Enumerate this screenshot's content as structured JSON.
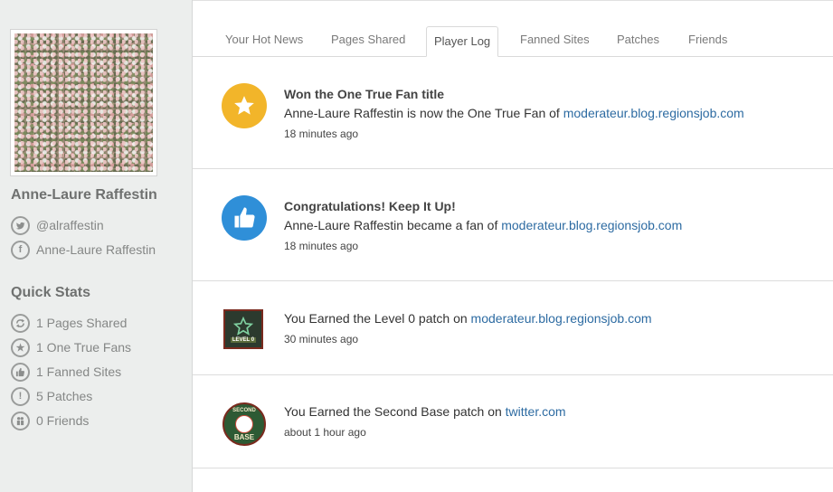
{
  "profile": {
    "name": "Anne-Laure Raffestin",
    "twitter": "@alraffestin",
    "facebook": "Anne-Laure Raffestin"
  },
  "quick_stats": {
    "title": "Quick Stats",
    "items": [
      {
        "label": "1 Pages Shared",
        "icon": "share-icon"
      },
      {
        "label": "1 One True Fans",
        "icon": "star-icon"
      },
      {
        "label": "1 Fanned Sites",
        "icon": "thumbs-up-icon"
      },
      {
        "label": "5 Patches",
        "icon": "exclamation-icon"
      },
      {
        "label": "0 Friends",
        "icon": "friends-icon"
      }
    ]
  },
  "tabs": [
    {
      "label": "Your Hot News",
      "active": false
    },
    {
      "label": "Pages Shared",
      "active": false
    },
    {
      "label": "Player Log",
      "active": true
    },
    {
      "label": "Fanned Sites",
      "active": false
    },
    {
      "label": "Patches",
      "active": false
    },
    {
      "label": "Friends",
      "active": false
    }
  ],
  "feed": [
    {
      "icon": "star-icon",
      "title": "Won the One True Fan title",
      "prefix": "Anne-Laure Raffestin is now the One True Fan of ",
      "link": "moderateur.blog.regionsjob.com",
      "time": "18 minutes ago"
    },
    {
      "icon": "thumbs-up-icon",
      "title": "Congratulations! Keep It Up!",
      "prefix": "Anne-Laure Raffestin became a fan of ",
      "link": "moderateur.blog.regionsjob.com",
      "time": "18 minutes ago"
    },
    {
      "icon": "level-patch-icon",
      "patch_label": "LEVEL 0",
      "prefix": "You Earned the Level 0 patch on ",
      "link": "moderateur.blog.regionsjob.com",
      "time": "30 minutes ago"
    },
    {
      "icon": "second-base-patch-icon",
      "patch_top": "SECOND",
      "patch_bottom": "BASE",
      "prefix": "You Earned the Second Base patch on ",
      "link": "twitter.com",
      "time": "about 1 hour ago"
    }
  ],
  "colors": {
    "sidebar_bg": "#eceeed",
    "link": "#2d6ba2",
    "star_badge": "#f2b52a",
    "thumb_badge": "#2f8fd8"
  }
}
